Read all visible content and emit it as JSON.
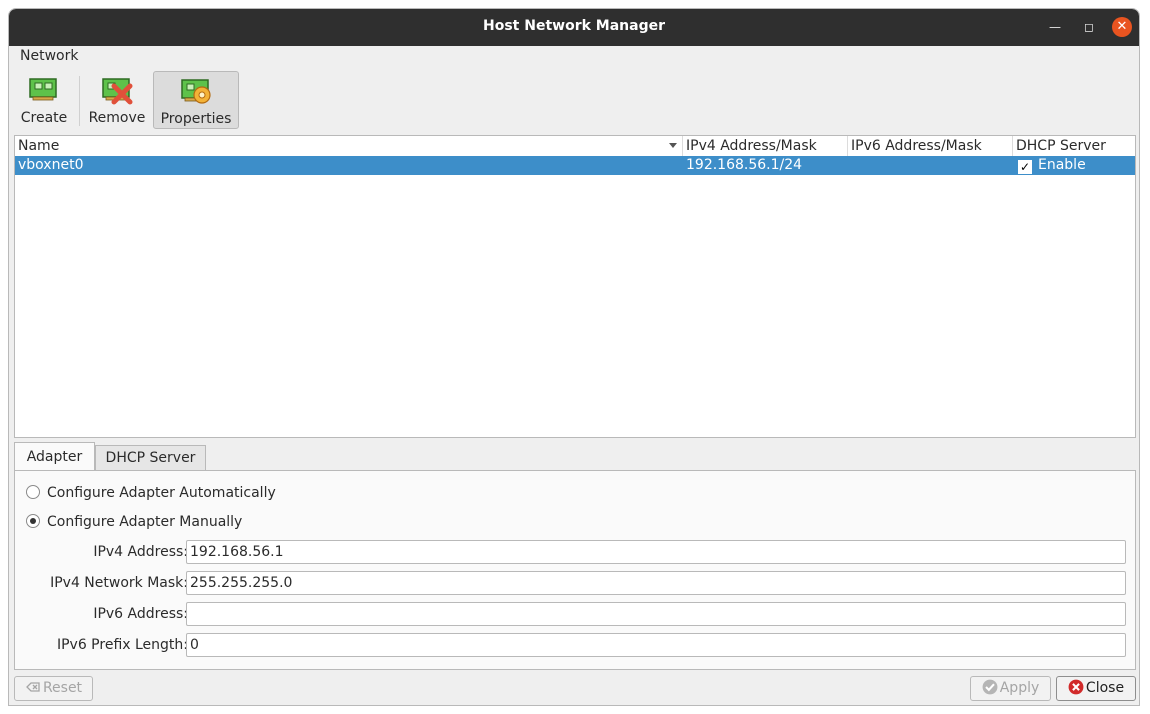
{
  "window": {
    "title": "Host Network Manager"
  },
  "menubar": {
    "network_label": "Network"
  },
  "toolbar": {
    "create_label": "Create",
    "remove_label": "Remove",
    "properties_label": "Properties"
  },
  "table": {
    "columns": [
      "Name",
      "IPv4 Address/Mask",
      "IPv6 Address/Mask",
      "DHCP Server"
    ],
    "rows": [
      {
        "name": "vboxnet0",
        "ipv4": "192.168.56.1/24",
        "ipv6": "",
        "dhcp": "Enable",
        "dhcp_checked": true
      }
    ]
  },
  "tabs": {
    "adapter": "Adapter",
    "dhcp_server": "DHCP Server"
  },
  "adapter": {
    "auto_label": "Configure Adapter Automatically",
    "manual_label": "Configure Adapter Manually",
    "selected": "manual",
    "fields": {
      "ipv4_address_label": "IPv4 Address:",
      "ipv4_address_value": "192.168.56.1",
      "ipv4_mask_label": "IPv4 Network Mask:",
      "ipv4_mask_value": "255.255.255.0",
      "ipv6_address_label": "IPv6 Address:",
      "ipv6_address_value": "",
      "ipv6_prefix_label": "IPv6 Prefix Length:",
      "ipv6_prefix_value": "0"
    }
  },
  "buttons": {
    "reset": "Reset",
    "apply": "Apply",
    "close": "Close"
  },
  "colors": {
    "selection": "#3d8ec9",
    "titlebar": "#2f2f2f",
    "close_accent": "#e95420"
  }
}
